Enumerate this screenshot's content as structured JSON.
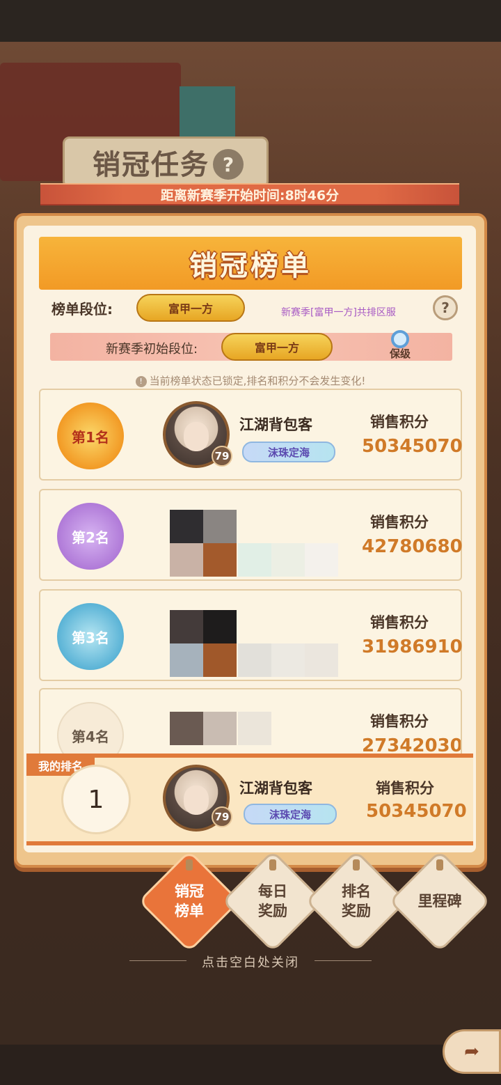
{
  "header": {
    "task_title": "销冠任务",
    "help_icon": "?",
    "season_countdown": "距离新赛季开始时间:8时46分"
  },
  "panel": {
    "title": "销冠榜单",
    "tier_label": "榜单段位:",
    "tier_name": "富甲一方",
    "tier_note": "新赛季[富甲一方]共排区服",
    "initial_tier_label": "新赛季初始段位:",
    "initial_tier_name": "富甲一方",
    "keep_label": "保级",
    "lock_notice": "当前榜单状态已锁定,排名和积分不会发生变化!"
  },
  "ranks": [
    {
      "rank_label": "第1名",
      "name": "江湖背包客",
      "level": "79",
      "title_tag": "沫珠定海",
      "score_title": "销售积分",
      "score": "50345070",
      "medal_color": "#f29a25"
    },
    {
      "rank_label": "第2名",
      "score_title": "销售积分",
      "score": "42780680",
      "medal_color": "#b07ad8"
    },
    {
      "rank_label": "第3名",
      "score_title": "销售积分",
      "score": "31986910",
      "medal_color": "#5ab3d6"
    },
    {
      "rank_label": "第4名",
      "score_title": "销售积分",
      "score": "27342030"
    }
  ],
  "my_rank": {
    "tag": "我的排名",
    "rank": "1",
    "name": "江湖背包客",
    "level": "79",
    "title_tag": "沫珠定海",
    "score_title": "销售积分",
    "score": "50345070"
  },
  "tabs": [
    {
      "label_line1": "销冠",
      "label_line2": "榜单",
      "active": true
    },
    {
      "label_line1": "每日",
      "label_line2": "奖励",
      "active": false
    },
    {
      "label_line1": "排名",
      "label_line2": "奖励",
      "active": false
    },
    {
      "label_line1": "里程碑",
      "label_line2": "",
      "active": false
    }
  ],
  "close_hint": "点击空白处关闭",
  "colors": {
    "accent_orange": "#e07a3a",
    "score_orange": "#d07a28",
    "tier_gold": "#f6d35a",
    "note_purple": "#a85bc4"
  }
}
